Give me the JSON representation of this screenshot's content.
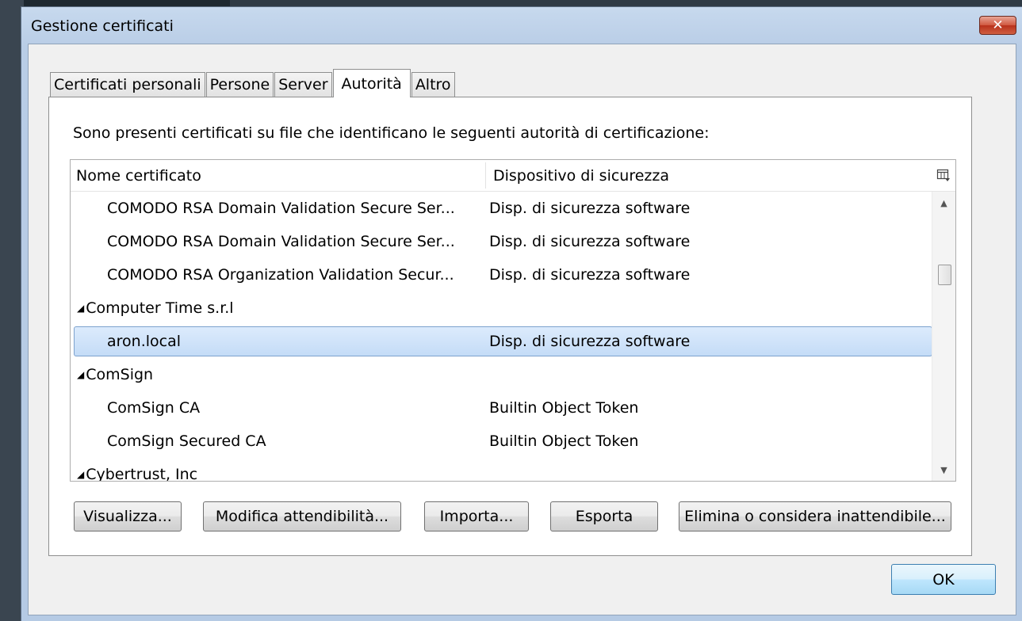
{
  "window": {
    "title": "Gestione certificati",
    "close_label": "✕"
  },
  "tabs": [
    {
      "label": "Certificati personali",
      "active": false
    },
    {
      "label": "Persone",
      "active": false
    },
    {
      "label": "Server",
      "active": false
    },
    {
      "label": "Autorità",
      "active": true
    },
    {
      "label": "Altro",
      "active": false
    }
  ],
  "description": "Sono presenti certificati su file che identificano le seguenti autorità di certificazione:",
  "columns": {
    "name": "Nome certificato",
    "device": "Dispositivo di sicurezza"
  },
  "rows": [
    {
      "type": "child",
      "name": "COMODO RSA Domain Validation Secure Ser...",
      "device": "Disp. di sicurezza software"
    },
    {
      "type": "child",
      "name": "COMODO RSA Domain Validation Secure Ser...",
      "device": "Disp. di sicurezza software"
    },
    {
      "type": "child",
      "name": "COMODO RSA Organization Validation Secur...",
      "device": "Disp. di sicurezza software"
    },
    {
      "type": "group",
      "name": "Computer Time s.r.l",
      "device": ""
    },
    {
      "type": "child",
      "name": "aron.local",
      "device": "Disp. di sicurezza software",
      "selected": true
    },
    {
      "type": "group",
      "name": "ComSign",
      "device": ""
    },
    {
      "type": "child",
      "name": "ComSign CA",
      "device": "Builtin Object Token"
    },
    {
      "type": "child",
      "name": "ComSign Secured CA",
      "device": "Builtin Object Token"
    },
    {
      "type": "group",
      "name": "Cybertrust, Inc",
      "device": ""
    }
  ],
  "buttons": {
    "view": "Visualizza...",
    "edit_trust": "Modifica attendibilità...",
    "import": "Importa...",
    "export": "Esporta",
    "delete": "Elimina o considera inattendibile...",
    "ok": "OK"
  },
  "icons": {
    "close": "close-icon",
    "expander": "triangle-expanded-icon",
    "column_picker": "column-picker-icon",
    "scroll_up": "arrow-up-icon",
    "scroll_down": "arrow-down-icon"
  }
}
